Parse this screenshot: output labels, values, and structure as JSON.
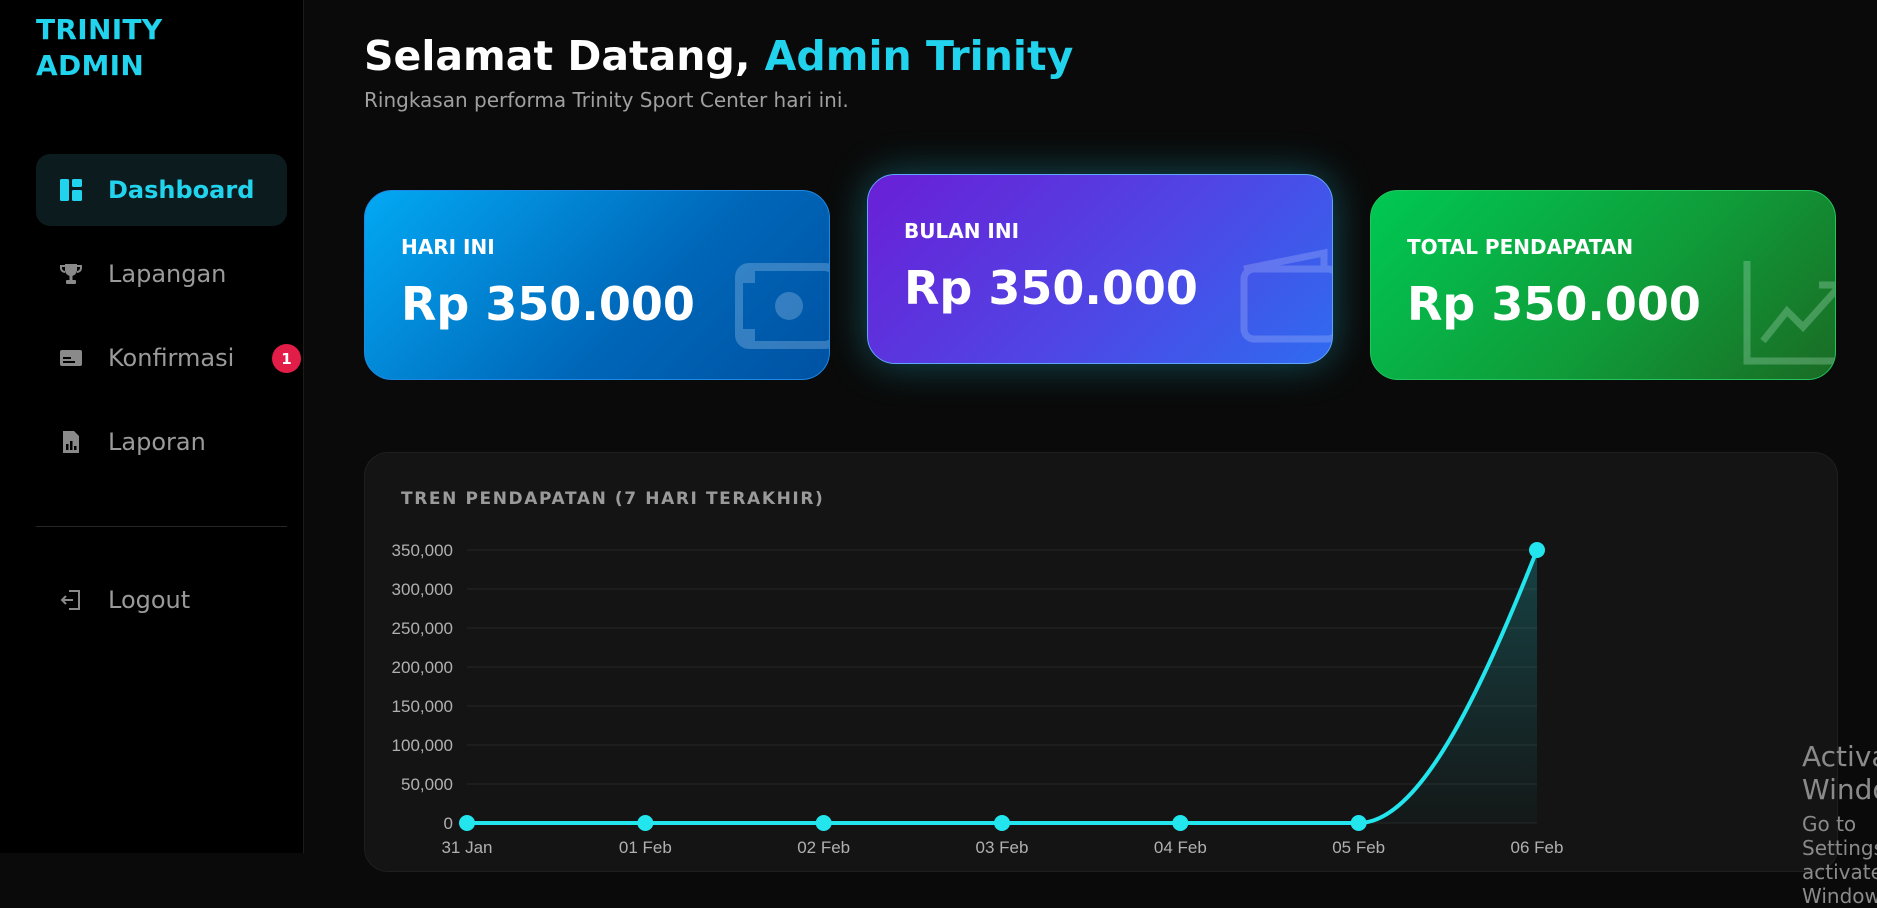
{
  "sidebar": {
    "brand_line1": "TRINITY",
    "brand_line2": "ADMIN",
    "items": [
      {
        "label": "Dashboard",
        "icon": "dashboard-icon",
        "active": true
      },
      {
        "label": "Lapangan",
        "icon": "trophy-icon"
      },
      {
        "label": "Konfirmasi",
        "icon": "payment-card-icon",
        "badge": "1"
      },
      {
        "label": "Laporan",
        "icon": "report-file-icon"
      }
    ],
    "logout_label": "Logout"
  },
  "header": {
    "greeting_prefix": "Selamat Datang, ",
    "greeting_name": "Admin Trinity",
    "subtitle": "Ringkasan performa Trinity Sport Center hari ini."
  },
  "cards": [
    {
      "label": "HARI INI",
      "amount": "Rp 350.000",
      "icon": "cash-icon",
      "color": "#03a9f4"
    },
    {
      "label": "BULAN INI",
      "amount": "Rp 350.000",
      "icon": "wallet-icon",
      "color": "#4f46e5"
    },
    {
      "label": "TOTAL PENDAPATAN",
      "amount": "Rp 350.000",
      "icon": "trend-up-icon",
      "color": "#00c853"
    }
  ],
  "chart_data": {
    "type": "area",
    "title": "TREN PENDAPATAN (7 HARI TERAKHIR)",
    "categories": [
      "31 Jan",
      "01 Feb",
      "02 Feb",
      "03 Feb",
      "04 Feb",
      "05 Feb",
      "06 Feb"
    ],
    "values": [
      0,
      0,
      0,
      0,
      0,
      0,
      350000
    ],
    "ylim": [
      0,
      350000
    ],
    "yticks": [
      0,
      50000,
      100000,
      150000,
      200000,
      250000,
      300000,
      350000
    ],
    "ytick_labels": [
      "0",
      "50,000",
      "100,000",
      "150,000",
      "200,000",
      "250,000",
      "300,000",
      "350,000"
    ],
    "color": "#22e5ee",
    "grid": true
  },
  "watermark": {
    "line1": "Activate Windows",
    "line2": "Go to Settings to activate Windows."
  }
}
